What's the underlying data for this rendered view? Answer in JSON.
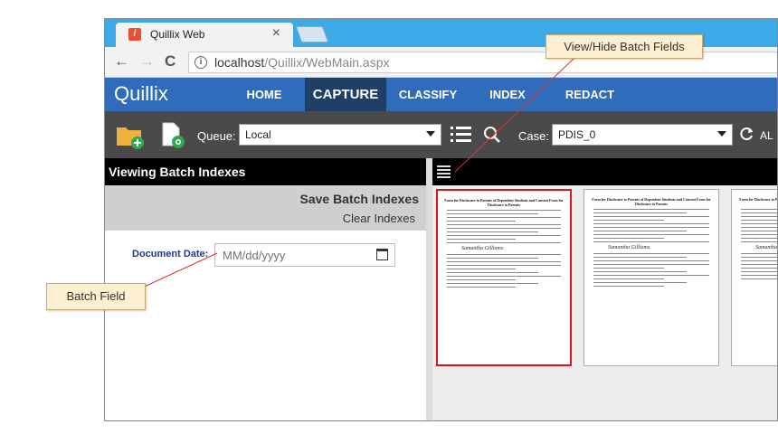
{
  "browser": {
    "tab_title": "Quillix Web",
    "tab_close": "×",
    "url_host": "localhost",
    "url_path": "/Quillix/WebMain.aspx",
    "back": "←",
    "forward": "→",
    "reload": "C"
  },
  "app": {
    "logo": "Quillix",
    "nav": [
      "HOME",
      "CAPTURE",
      "CLASSIFY",
      "INDEX",
      "REDACT"
    ],
    "active_nav": "CAPTURE"
  },
  "toolbar": {
    "queue_label": "Queue:",
    "queue_value": "Local",
    "case_label": "Case:",
    "case_value": "PDIS_0",
    "refresh_label": "AL"
  },
  "left_panel": {
    "header": "Viewing Batch Indexes",
    "save": "Save Batch Indexes",
    "clear": "Clear Indexes",
    "field_label": "Document Date:",
    "field_placeholder": "MM/dd/yyyy"
  },
  "callouts": {
    "view_hide": "View/Hide Batch Fields",
    "batch_field": "Batch Field"
  },
  "thumbnails": {
    "doc_title": "Form for Disclosure to Parents of Dependent Students and Consent Form for Disclosure to Parents",
    "signature": "Samantha Gilliams",
    "count": 3,
    "selected_index": 0
  },
  "colors": {
    "tabstrip": "#3daae8",
    "header": "#2f6cbb",
    "active_nav": "#1f3f66",
    "toolbar": "#4a4a4a",
    "selected_border": "#e0131a"
  }
}
